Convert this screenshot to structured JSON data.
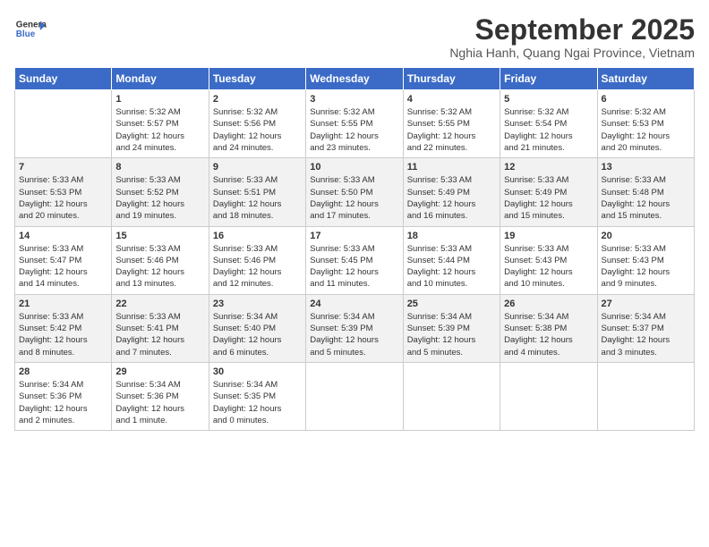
{
  "header": {
    "logo_line1": "General",
    "logo_line2": "Blue",
    "month": "September 2025",
    "location": "Nghia Hanh, Quang Ngai Province, Vietnam"
  },
  "days_of_week": [
    "Sunday",
    "Monday",
    "Tuesday",
    "Wednesday",
    "Thursday",
    "Friday",
    "Saturday"
  ],
  "weeks": [
    [
      {
        "day": "",
        "info": ""
      },
      {
        "day": "1",
        "info": "Sunrise: 5:32 AM\nSunset: 5:57 PM\nDaylight: 12 hours\nand 24 minutes."
      },
      {
        "day": "2",
        "info": "Sunrise: 5:32 AM\nSunset: 5:56 PM\nDaylight: 12 hours\nand 24 minutes."
      },
      {
        "day": "3",
        "info": "Sunrise: 5:32 AM\nSunset: 5:55 PM\nDaylight: 12 hours\nand 23 minutes."
      },
      {
        "day": "4",
        "info": "Sunrise: 5:32 AM\nSunset: 5:55 PM\nDaylight: 12 hours\nand 22 minutes."
      },
      {
        "day": "5",
        "info": "Sunrise: 5:32 AM\nSunset: 5:54 PM\nDaylight: 12 hours\nand 21 minutes."
      },
      {
        "day": "6",
        "info": "Sunrise: 5:32 AM\nSunset: 5:53 PM\nDaylight: 12 hours\nand 20 minutes."
      }
    ],
    [
      {
        "day": "7",
        "info": "Sunrise: 5:33 AM\nSunset: 5:53 PM\nDaylight: 12 hours\nand 20 minutes."
      },
      {
        "day": "8",
        "info": "Sunrise: 5:33 AM\nSunset: 5:52 PM\nDaylight: 12 hours\nand 19 minutes."
      },
      {
        "day": "9",
        "info": "Sunrise: 5:33 AM\nSunset: 5:51 PM\nDaylight: 12 hours\nand 18 minutes."
      },
      {
        "day": "10",
        "info": "Sunrise: 5:33 AM\nSunset: 5:50 PM\nDaylight: 12 hours\nand 17 minutes."
      },
      {
        "day": "11",
        "info": "Sunrise: 5:33 AM\nSunset: 5:49 PM\nDaylight: 12 hours\nand 16 minutes."
      },
      {
        "day": "12",
        "info": "Sunrise: 5:33 AM\nSunset: 5:49 PM\nDaylight: 12 hours\nand 15 minutes."
      },
      {
        "day": "13",
        "info": "Sunrise: 5:33 AM\nSunset: 5:48 PM\nDaylight: 12 hours\nand 15 minutes."
      }
    ],
    [
      {
        "day": "14",
        "info": "Sunrise: 5:33 AM\nSunset: 5:47 PM\nDaylight: 12 hours\nand 14 minutes."
      },
      {
        "day": "15",
        "info": "Sunrise: 5:33 AM\nSunset: 5:46 PM\nDaylight: 12 hours\nand 13 minutes."
      },
      {
        "day": "16",
        "info": "Sunrise: 5:33 AM\nSunset: 5:46 PM\nDaylight: 12 hours\nand 12 minutes."
      },
      {
        "day": "17",
        "info": "Sunrise: 5:33 AM\nSunset: 5:45 PM\nDaylight: 12 hours\nand 11 minutes."
      },
      {
        "day": "18",
        "info": "Sunrise: 5:33 AM\nSunset: 5:44 PM\nDaylight: 12 hours\nand 10 minutes."
      },
      {
        "day": "19",
        "info": "Sunrise: 5:33 AM\nSunset: 5:43 PM\nDaylight: 12 hours\nand 10 minutes."
      },
      {
        "day": "20",
        "info": "Sunrise: 5:33 AM\nSunset: 5:43 PM\nDaylight: 12 hours\nand 9 minutes."
      }
    ],
    [
      {
        "day": "21",
        "info": "Sunrise: 5:33 AM\nSunset: 5:42 PM\nDaylight: 12 hours\nand 8 minutes."
      },
      {
        "day": "22",
        "info": "Sunrise: 5:33 AM\nSunset: 5:41 PM\nDaylight: 12 hours\nand 7 minutes."
      },
      {
        "day": "23",
        "info": "Sunrise: 5:34 AM\nSunset: 5:40 PM\nDaylight: 12 hours\nand 6 minutes."
      },
      {
        "day": "24",
        "info": "Sunrise: 5:34 AM\nSunset: 5:39 PM\nDaylight: 12 hours\nand 5 minutes."
      },
      {
        "day": "25",
        "info": "Sunrise: 5:34 AM\nSunset: 5:39 PM\nDaylight: 12 hours\nand 5 minutes."
      },
      {
        "day": "26",
        "info": "Sunrise: 5:34 AM\nSunset: 5:38 PM\nDaylight: 12 hours\nand 4 minutes."
      },
      {
        "day": "27",
        "info": "Sunrise: 5:34 AM\nSunset: 5:37 PM\nDaylight: 12 hours\nand 3 minutes."
      }
    ],
    [
      {
        "day": "28",
        "info": "Sunrise: 5:34 AM\nSunset: 5:36 PM\nDaylight: 12 hours\nand 2 minutes."
      },
      {
        "day": "29",
        "info": "Sunrise: 5:34 AM\nSunset: 5:36 PM\nDaylight: 12 hours\nand 1 minute."
      },
      {
        "day": "30",
        "info": "Sunrise: 5:34 AM\nSunset: 5:35 PM\nDaylight: 12 hours\nand 0 minutes."
      },
      {
        "day": "",
        "info": ""
      },
      {
        "day": "",
        "info": ""
      },
      {
        "day": "",
        "info": ""
      },
      {
        "day": "",
        "info": ""
      }
    ]
  ]
}
